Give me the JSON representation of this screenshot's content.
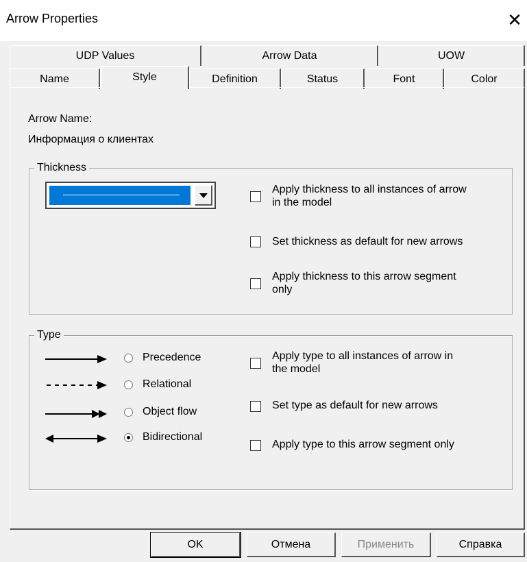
{
  "window": {
    "title": "Arrow Properties",
    "close_glyph": "✕"
  },
  "tabs_top": [
    {
      "label": "UDP Values"
    },
    {
      "label": "Arrow Data"
    },
    {
      "label": "UOW"
    }
  ],
  "tabs_bottom": [
    {
      "label": "Name"
    },
    {
      "label": "Style",
      "selected": true
    },
    {
      "label": "Definition"
    },
    {
      "label": "Status"
    },
    {
      "label": "Font"
    },
    {
      "label": "Color"
    }
  ],
  "arrow": {
    "name_label": "Arrow Name:",
    "name_value": "Информация о клиентах"
  },
  "thickness": {
    "group_label": "Thickness",
    "selected_style": "thin-line",
    "options": [
      {
        "label": "Apply thickness to all instances of arrow",
        "label2": "in the model",
        "checked": false
      },
      {
        "label": "Set thickness as default for new arrows",
        "checked": false
      },
      {
        "label": "Apply thickness to this arrow segment",
        "label2": "only",
        "checked": false
      }
    ]
  },
  "type": {
    "group_label": "Type",
    "radios": [
      {
        "label": "Precedence",
        "icon": "precedence-arrow-icon",
        "selected": false
      },
      {
        "label": "Relational",
        "icon": "relational-arrow-icon",
        "selected": false
      },
      {
        "label": "Object flow",
        "icon": "object-flow-arrow-icon",
        "selected": false
      },
      {
        "label": "Bidirectional",
        "icon": "bidirectional-arrow-icon",
        "selected": true
      }
    ],
    "options": [
      {
        "label": "Apply type to all instances of arrow in",
        "label2": "the model",
        "checked": false
      },
      {
        "label": "Set type as default for new arrows",
        "checked": false
      },
      {
        "label": "Apply type to this arrow segment only",
        "checked": false
      }
    ]
  },
  "buttons": {
    "ok": "OK",
    "cancel": "Отмена",
    "apply": "Применить",
    "help": "Справка"
  },
  "colors": {
    "selection": "#0078d7",
    "face": "#f0f0f0",
    "disabled_text": "#8a8a8a"
  }
}
